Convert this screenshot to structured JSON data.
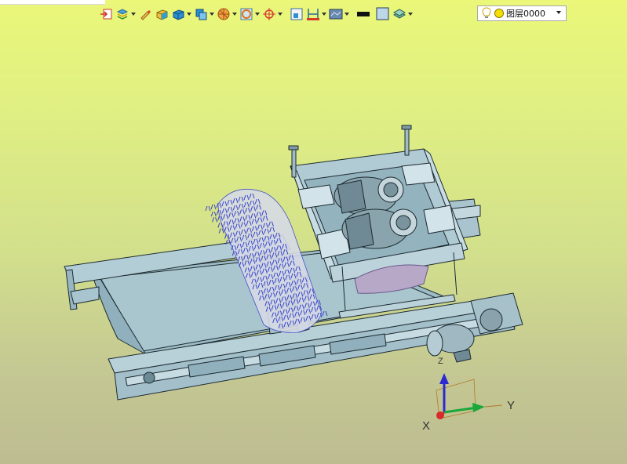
{
  "toolbar": {
    "buttons": [
      {
        "icon": "import-icon",
        "dropdown": false
      },
      {
        "icon": "layers-stack-icon",
        "dropdown": true
      },
      {
        "icon": "pen-icon",
        "dropdown": false
      },
      {
        "icon": "solid-box-icon",
        "dropdown": false
      },
      {
        "icon": "shaded-box-icon",
        "dropdown": true
      },
      {
        "icon": "view-cube-icon",
        "dropdown": true
      },
      {
        "icon": "section-sphere-icon",
        "dropdown": true
      },
      {
        "icon": "target-frame-icon",
        "dropdown": true
      },
      {
        "icon": "snap-crosshair-icon",
        "dropdown": true
      },
      {
        "icon": "select-box-icon",
        "dropdown": false
      },
      {
        "icon": "dimension-icon",
        "dropdown": true
      },
      {
        "icon": "render-mode-icon",
        "dropdown": true
      },
      {
        "icon": "line-color-icon",
        "dropdown": false
      },
      {
        "icon": "fill-color-icon",
        "dropdown": false
      },
      {
        "icon": "layer-stack-icon",
        "dropdown": true
      }
    ],
    "layer": {
      "label": "图层0000",
      "bulb_color": "#f5d800",
      "dot_color": "#f3e000"
    }
  },
  "axes": {
    "x_label": "X",
    "y_label": "Y",
    "z_label": "Z"
  },
  "colors": {
    "viewport_top": "#eaf779",
    "viewport_bottom": "#bdbc91",
    "model_fill": "#9fbcc6",
    "model_edge": "#1d2a30",
    "brush_bristle": "#3a43c8"
  }
}
